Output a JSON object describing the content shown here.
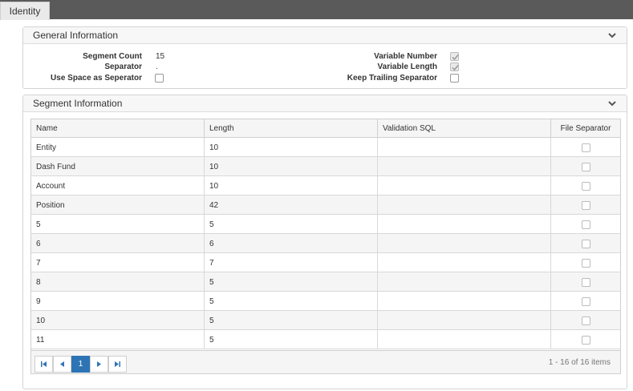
{
  "tabs": [
    {
      "label": "Identity"
    }
  ],
  "general": {
    "title": "General Information",
    "segment_count_label": "Segment Count",
    "segment_count": "15",
    "separator_label": "Separator",
    "separator": ".",
    "use_space_label": "Use Space as Seperator",
    "use_space_checked": false,
    "variable_number_label": "Variable Number",
    "variable_number_checked": true,
    "variable_length_label": "Variable Length",
    "variable_length_checked": true,
    "keep_trailing_label": "Keep Trailing Separator",
    "keep_trailing_checked": false
  },
  "segment": {
    "title": "Segment Information",
    "columns": [
      "Name",
      "Length",
      "Validation SQL",
      "File Separator"
    ],
    "rows": [
      {
        "name": "Entity",
        "length": "10",
        "sql": "",
        "file_separator": false
      },
      {
        "name": "Dash Fund",
        "length": "10",
        "sql": "",
        "file_separator": false
      },
      {
        "name": "Account",
        "length": "10",
        "sql": "",
        "file_separator": false
      },
      {
        "name": "Position",
        "length": "42",
        "sql": "",
        "file_separator": false
      },
      {
        "name": "5",
        "length": "5",
        "sql": "",
        "file_separator": false
      },
      {
        "name": "6",
        "length": "6",
        "sql": "",
        "file_separator": false
      },
      {
        "name": "7",
        "length": "7",
        "sql": "",
        "file_separator": false
      },
      {
        "name": "8",
        "length": "5",
        "sql": "",
        "file_separator": false
      },
      {
        "name": "9",
        "length": "5",
        "sql": "",
        "file_separator": false
      },
      {
        "name": "10",
        "length": "5",
        "sql": "",
        "file_separator": false
      },
      {
        "name": "11",
        "length": "5",
        "sql": "",
        "file_separator": false
      }
    ],
    "pager": {
      "current_page": "1",
      "info": "1 - 16 of 16 items"
    }
  },
  "colors": {
    "topbar": "#5a5a5a",
    "active_page": "#2e74b5",
    "row_alt": "#f5f5f5"
  }
}
